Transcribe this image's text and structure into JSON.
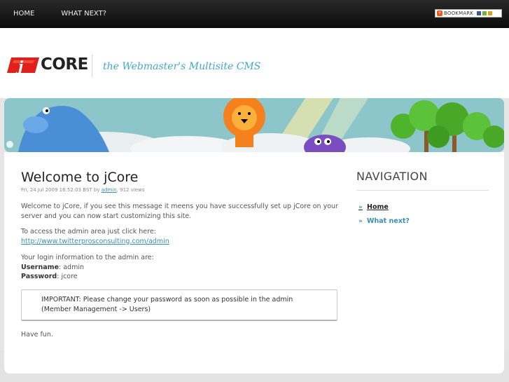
{
  "topnav": {
    "items": [
      "HOME",
      "WHAT NEXT?"
    ],
    "bookmark_label": "BOOKMARK"
  },
  "header": {
    "logo_text": "CORE",
    "tagline": "the Webmaster's Multisite CMS"
  },
  "post": {
    "title": "Welcome to jCore",
    "meta_date": "Fri, 24 Jul 2009 16:52:03 BST by ",
    "meta_author": "admin",
    "meta_views": ", 912 views",
    "p1": "Welcome to jCore, if you see this message it meens you have successfully set up jCore on your server and you can now start customizing this site.",
    "p2_text": "To access the admin area just click here:",
    "p2_link": "http://www.twitterprosconsulting.com/admin",
    "p3_intro": "Your login information to the admin are:",
    "username_label": "Username",
    "username_value": ": admin",
    "password_label": "Password",
    "password_value": ": jcore",
    "notice": "IMPORTANT: Please change your password as soon as possible in the admin (Member Management -> Users)",
    "closing": "Have fun."
  },
  "sidebar": {
    "title": "NAVIGATION",
    "items": [
      "Home",
      "What next?"
    ]
  },
  "colors": {
    "accent": "#3a8fb7",
    "tagline": "#3fa8c9",
    "topbar": "#111111",
    "logo_red": "#e0201b"
  },
  "icons": [
    "bookmark-icon",
    "chevron-right-icon"
  ]
}
